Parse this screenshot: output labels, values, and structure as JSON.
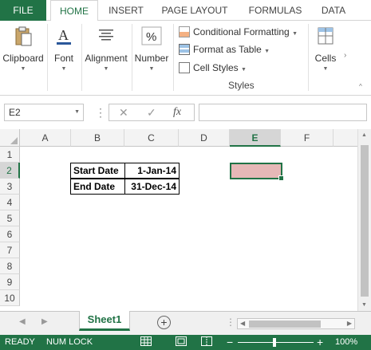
{
  "ribbon_tabs": [
    "FILE",
    "HOME",
    "INSERT",
    "PAGE LAYOUT",
    "FORMULAS",
    "DATA"
  ],
  "ribbon": {
    "clipboard": "Clipboard",
    "font": "Font",
    "alignment": "Alignment",
    "number": "Number",
    "conditional_formatting": "Conditional Formatting",
    "format_as_table": "Format as Table",
    "cell_styles": "Cell Styles",
    "styles_group": "Styles",
    "cells": "Cells"
  },
  "formula_bar": {
    "name_box": "E2",
    "fx": "fx",
    "formula": ""
  },
  "columns": [
    "A",
    "B",
    "C",
    "D",
    "E",
    "F"
  ],
  "selected_column": "E",
  "rows": [
    "1",
    "2",
    "3",
    "4",
    "5",
    "6",
    "7",
    "8",
    "9",
    "10"
  ],
  "selected_row": "2",
  "cells": {
    "B2": "Start Date",
    "C2": "1-Jan-14",
    "B3": "End Date",
    "C3": "31-Dec-14"
  },
  "selected_cell_fill": "#e6b8b7",
  "sheet_tab": "Sheet1",
  "status": {
    "ready": "READY",
    "num_lock": "NUM LOCK",
    "zoom": "100%"
  },
  "accent_color": "#217346"
}
